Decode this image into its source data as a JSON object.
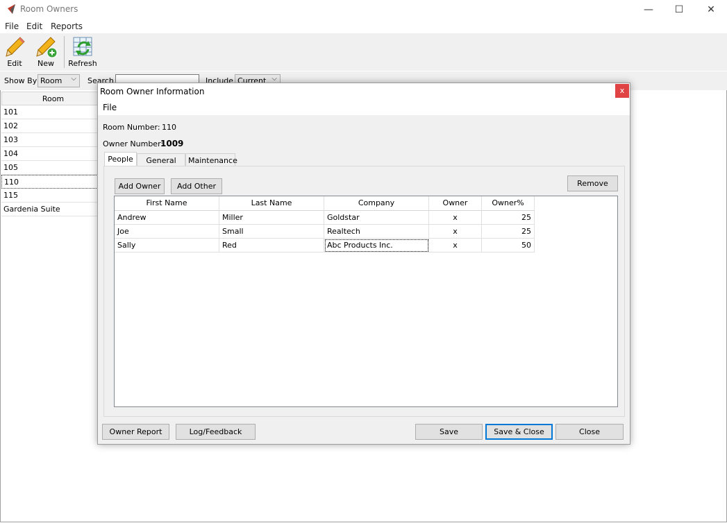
{
  "window": {
    "title": "Room Owners",
    "minimize": "—",
    "maximize": "☐",
    "close": "✕"
  },
  "menu": [
    "File",
    "Edit",
    "Reports"
  ],
  "toolbar": {
    "edit": "Edit",
    "new": "New",
    "refresh": "Refresh"
  },
  "filter": {
    "show_by_label": "Show By",
    "show_by_value": "Room",
    "search_label": "Search",
    "search_value": "",
    "include_label": "Include",
    "include_value": "Current"
  },
  "room_list": {
    "header": "Room",
    "rows": [
      "101",
      "102",
      "103",
      "104",
      "105",
      "110",
      "115",
      "Gardenia Suite"
    ],
    "selected": "110"
  },
  "dialog": {
    "title": "Room Owner Information",
    "close": "x",
    "menu_file": "File",
    "room_number_label": "Room Number:",
    "room_number": "110",
    "owner_number_label": "Owner Number:",
    "owner_number": "1009",
    "tabs": [
      "People",
      "General Info",
      "Maintenance"
    ],
    "active_tab": "People",
    "buttons": {
      "add_owner": "Add Owner",
      "add_other": "Add Other",
      "remove": "Remove",
      "owner_report": "Owner Report",
      "log_feedback": "Log/Feedback",
      "save": "Save",
      "save_close": "Save & Close",
      "close": "Close"
    },
    "grid": {
      "columns": [
        "First Name",
        "Last Name",
        "Company",
        "Owner",
        "Owner%"
      ],
      "rows": [
        [
          "Andrew",
          "Miller",
          "Goldstar",
          "x",
          "25"
        ],
        [
          "Joe",
          "Small",
          "Realtech",
          "x",
          "25"
        ],
        [
          "Sally",
          "Red",
          "Abc Products Inc.",
          "x",
          "50"
        ]
      ]
    }
  }
}
